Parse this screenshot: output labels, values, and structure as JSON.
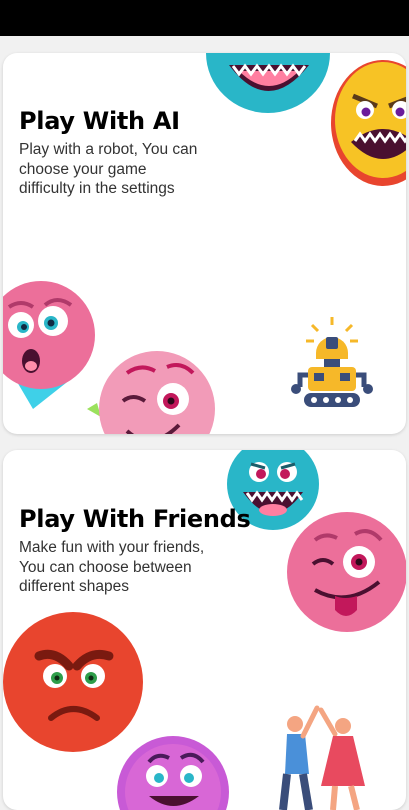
{
  "cards": [
    {
      "title": "Play With AI",
      "description": "Play with a robot, You can choose your game difficulty in the settings"
    },
    {
      "title": "Play With Friends",
      "description": "Make fun with your friends, You can choose between different shapes"
    }
  ],
  "icons": {
    "card_ai": [
      "teal-monster-icon",
      "yellow-angry-monster-icon",
      "pink-surprised-monster-icon",
      "pink-winking-monster-icon",
      "robot-icon"
    ],
    "card_friends": [
      "teal-monster-icon",
      "pink-tongue-monster-icon",
      "red-angry-monster-icon",
      "purple-monster-icon",
      "friends-high-five-icon"
    ]
  },
  "colors": {
    "teal": "#29b6c8",
    "yellow": "#f7c325",
    "pink": "#ec6f9a",
    "light_pink": "#f29bb8",
    "red": "#e8452e",
    "purple": "#c85ad6",
    "robot_yellow": "#f6b829",
    "robot_navy": "#3a4d7a"
  }
}
